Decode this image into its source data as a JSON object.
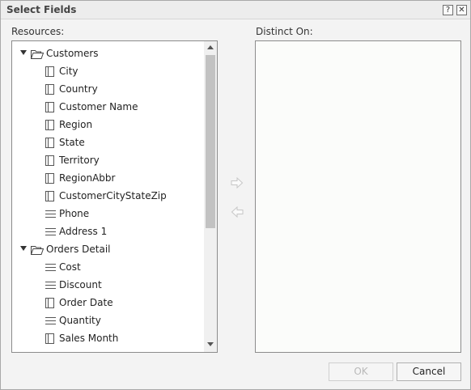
{
  "dialog": {
    "title": "Select Fields",
    "help_glyph": "?",
    "close_glyph": "✕"
  },
  "resources": {
    "label": "Resources:",
    "tree": [
      {
        "label": "Customers",
        "type": "folder",
        "expanded": true,
        "icon": "folder-icon"
      },
      {
        "label": "City",
        "type": "field",
        "icon": "dimension-field-icon"
      },
      {
        "label": "Country",
        "type": "field",
        "icon": "dimension-field-icon"
      },
      {
        "label": "Customer Name",
        "type": "field",
        "icon": "dimension-field-icon"
      },
      {
        "label": "Region",
        "type": "field",
        "icon": "dimension-field-icon"
      },
      {
        "label": "State",
        "type": "field",
        "icon": "dimension-field-icon"
      },
      {
        "label": "Territory",
        "type": "field",
        "icon": "dimension-field-icon"
      },
      {
        "label": "RegionAbbr",
        "type": "field",
        "icon": "dimension-field-icon"
      },
      {
        "label": "CustomerCityStateZip",
        "type": "field",
        "icon": "dimension-field-icon"
      },
      {
        "label": "Phone",
        "type": "field",
        "icon": "detail-field-icon"
      },
      {
        "label": "Address 1",
        "type": "field",
        "icon": "detail-field-icon"
      },
      {
        "label": "Orders Detail",
        "type": "folder",
        "expanded": true,
        "icon": "folder-icon"
      },
      {
        "label": "Cost",
        "type": "field",
        "icon": "detail-field-icon"
      },
      {
        "label": "Discount",
        "type": "field",
        "icon": "detail-field-icon"
      },
      {
        "label": "Order Date",
        "type": "field",
        "icon": "dimension-field-icon"
      },
      {
        "label": "Quantity",
        "type": "field",
        "icon": "detail-field-icon"
      },
      {
        "label": "Sales Month",
        "type": "field",
        "icon": "dimension-field-icon"
      }
    ]
  },
  "distinct_on": {
    "label": "Distinct On:",
    "items": []
  },
  "transfer": {
    "add_icon": "arrow-right-icon",
    "remove_icon": "arrow-left-icon"
  },
  "footer": {
    "ok_label": "OK",
    "cancel_label": "Cancel"
  },
  "colors": {
    "dialog_bg": "#f3f3f3",
    "panel_border": "#8c8c8c",
    "scroll_thumb": "#c2c2c2",
    "disabled_text": "#b9b9b9"
  }
}
